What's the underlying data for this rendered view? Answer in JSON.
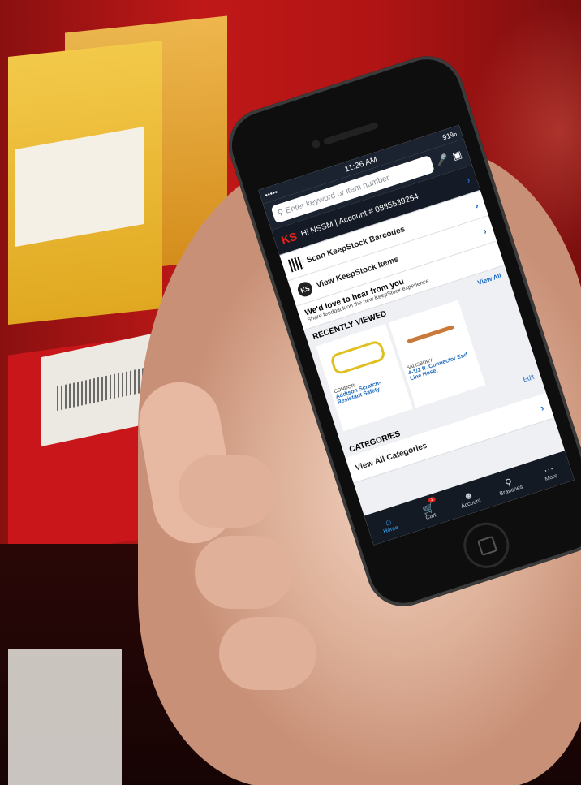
{
  "status": {
    "time": "11:26 AM",
    "battery": "91%",
    "signal": "•••••"
  },
  "search": {
    "placeholder": "Enter keyword or item number"
  },
  "account": {
    "greeting": "Hi NSSM | Account # 0885539254"
  },
  "menu": {
    "scan_label": "Scan KeepStock Barcodes",
    "view_label": "View KeepStock Items"
  },
  "feedback": {
    "title": "We'd love to hear from you",
    "subtitle": "Share feedback on the new KeepStock experience"
  },
  "recently_viewed": {
    "title": "RECENTLY VIEWED",
    "view_all": "View All",
    "edit": "Edit",
    "items": [
      {
        "brand": "CONDOR",
        "name": "Addison Scratch-Resistant Safety"
      },
      {
        "brand": "SALISBURY",
        "name": "4-1/2 ft. Connector End Line Hose,"
      }
    ]
  },
  "categories": {
    "title": "CATEGORIES",
    "view_all": "View All Categories"
  },
  "tabs": [
    {
      "label": "Home",
      "icon": "home-icon"
    },
    {
      "label": "Cart",
      "icon": "cart-icon",
      "badge": "1"
    },
    {
      "label": "Account",
      "icon": "person-icon"
    },
    {
      "label": "Branches",
      "icon": "map-pin-icon"
    },
    {
      "label": "More",
      "icon": "more-icon"
    }
  ],
  "logo": {
    "ks_left": "K",
    "ks_right": "S",
    "ks_circle": "KS"
  },
  "colors": {
    "accent": "#1d6ac0",
    "brand_red": "#e2231a",
    "header": "#1b2330"
  }
}
